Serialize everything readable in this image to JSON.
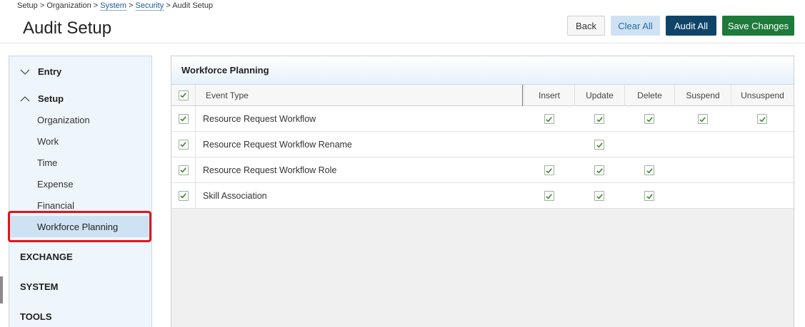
{
  "breadcrumb": {
    "items": [
      "Setup",
      "Organization",
      "System",
      "Security",
      "Audit Setup"
    ],
    "separator": ">"
  },
  "page": {
    "title": "Audit Setup"
  },
  "toolbar": {
    "back_label": "Back",
    "clear_all_label": "Clear All",
    "audit_all_label": "Audit All",
    "save_label": "Save Changes"
  },
  "sidebar": {
    "groups": [
      {
        "label": "Entry",
        "expanded": false
      },
      {
        "label": "Setup",
        "expanded": true
      }
    ],
    "setup_items": [
      "Organization",
      "Work",
      "Time",
      "Expense",
      "Financial",
      "Workforce Planning"
    ],
    "active_item": "Workforce Planning",
    "sections": [
      "EXCHANGE",
      "SYSTEM",
      "TOOLS"
    ]
  },
  "panel": {
    "title": "Workforce Planning",
    "columns": {
      "event_type": "Event Type",
      "insert": "Insert",
      "update": "Update",
      "delete": "Delete",
      "suspend": "Suspend",
      "unsuspend": "Unsuspend"
    },
    "rows": [
      {
        "name": "Resource Request Workflow",
        "selected": true,
        "insert": true,
        "update": true,
        "delete": true,
        "suspend": true,
        "unsuspend": true
      },
      {
        "name": "Resource Request Workflow Rename",
        "selected": true,
        "insert": false,
        "update": true,
        "delete": false,
        "suspend": false,
        "unsuspend": false
      },
      {
        "name": "Resource Request Workflow Role",
        "selected": true,
        "insert": true,
        "update": true,
        "delete": true,
        "suspend": false,
        "unsuspend": false
      },
      {
        "name": "Skill Association",
        "selected": true,
        "insert": true,
        "update": true,
        "delete": true,
        "suspend": false,
        "unsuspend": false
      }
    ]
  },
  "colors": {
    "accent_blue": "#0f4468",
    "save_green": "#1e7a3a",
    "check_green": "#3a8a2a",
    "highlight_red": "#e3141b",
    "active_bg": "#cfe2f3"
  },
  "icons": {
    "expand": "chevron-right-icon",
    "collapse": "chevron-up-icon",
    "check": "checkmark-icon"
  }
}
